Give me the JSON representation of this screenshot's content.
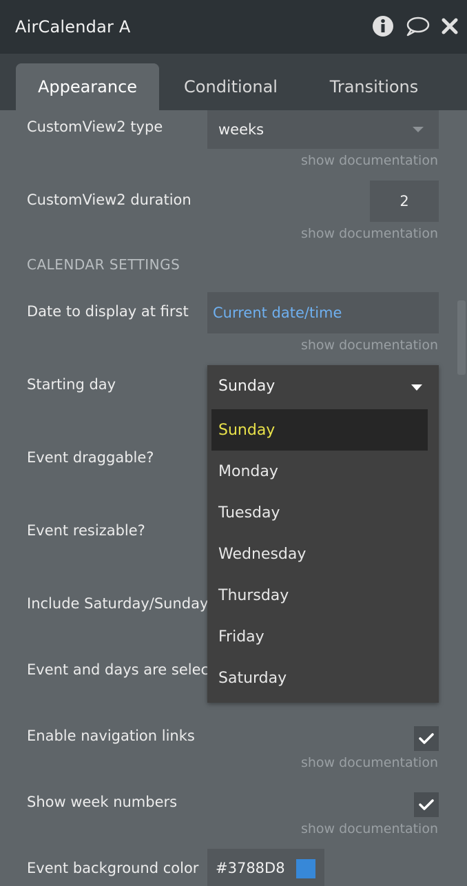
{
  "window": {
    "title": "AirCalendar A"
  },
  "tabs": [
    {
      "label": "Appearance",
      "active": true
    },
    {
      "label": "Conditional",
      "active": false
    },
    {
      "label": "Transitions",
      "active": false
    }
  ],
  "fields": {
    "customview2_type": {
      "label": "CustomView2 type",
      "value": "weeks",
      "doc": "show documentation"
    },
    "customview2_duration": {
      "label": "CustomView2 duration",
      "value": "2",
      "doc": "show documentation"
    },
    "section": "CALENDAR SETTINGS",
    "date_first": {
      "label": "Date to display at first",
      "value": "Current date/time",
      "doc": "show documentation"
    },
    "starting_day": {
      "label": "Starting day",
      "value": "Sunday"
    },
    "event_draggable": {
      "label": "Event draggable?"
    },
    "event_resizable": {
      "label": "Event resizable?"
    },
    "include_weekend": {
      "label": "Include Saturday/Sunday"
    },
    "selectable": {
      "label": "Event and days are selectable"
    },
    "nav_links": {
      "label": "Enable navigation links",
      "checked": true,
      "doc": "show documentation"
    },
    "week_numbers": {
      "label": "Show week numbers",
      "checked": true,
      "doc": "show documentation"
    },
    "event_bg": {
      "label": "Event background color",
      "value": "#3788D8"
    }
  },
  "dropdown": {
    "options": [
      "Sunday",
      "Monday",
      "Tuesday",
      "Wednesday",
      "Thursday",
      "Friday",
      "Saturday"
    ],
    "selected": "Sunday"
  },
  "colors": {
    "titlebar": "#2c3236",
    "panel": "#5f6569",
    "link": "#6fb0f0",
    "selected_text": "#e8e14a",
    "event_bg_swatch": "#3788D8"
  },
  "icons": [
    "info-icon",
    "comment-icon",
    "close-icon",
    "chevron-down-icon",
    "checkmark-icon"
  ]
}
